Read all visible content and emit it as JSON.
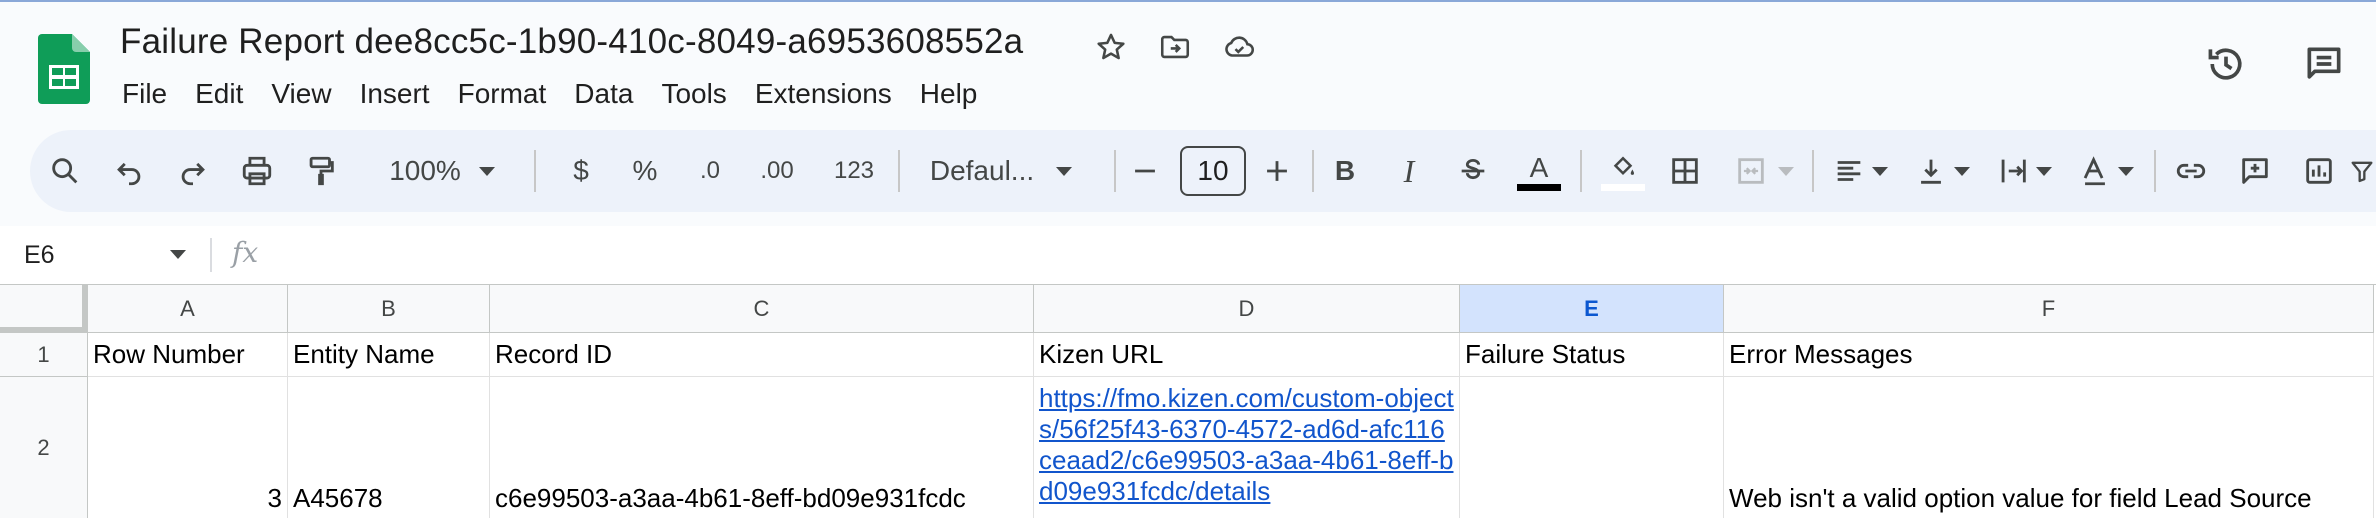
{
  "doc": {
    "title": "Failure Report dee8cc5c-1b90-410c-8049-a6953608552a"
  },
  "menu": [
    "File",
    "Edit",
    "View",
    "Insert",
    "Format",
    "Data",
    "Tools",
    "Extensions",
    "Help"
  ],
  "toolbar": {
    "zoom": "100%",
    "currency": "$",
    "percent": "%",
    "decrease_decimal": ".0",
    "increase_decimal": ".00",
    "more_formats": "123",
    "font": "Defaul...",
    "font_size": "10",
    "bold": "B",
    "italic": "I",
    "text_color": "A"
  },
  "formula_bar": {
    "cell_ref": "E6",
    "fx": "fx",
    "value": ""
  },
  "grid": {
    "columns": [
      "A",
      "B",
      "C",
      "D",
      "E",
      "F"
    ],
    "selected_column": "E",
    "rows": [
      "1",
      "2"
    ],
    "header_row": [
      "Row Number",
      "Entity Name",
      "Record ID",
      "Kizen URL",
      "Failure Status",
      "Error Messages"
    ],
    "data_row": {
      "row_number": "3",
      "entity_name": "A45678",
      "record_id": "c6e99503-a3aa-4b61-8eff-bd09e931fcdc",
      "kizen_url": "https://fmo.kizen.com/custom-objects/56f25f43-6370-4572-ad6d-afc116ceaad2/c6e99503-a3aa-4b61-8eff-bd09e931fcdc/details",
      "failure_status": "",
      "error_messages": "Web isn't a valid option value for field Lead Source"
    }
  },
  "colors": {
    "sheets_green": "#0f9d58",
    "link_blue": "#1155cc",
    "selected_header": "#d3e3fd",
    "toolbar_bg": "#edf2fa"
  },
  "icons": {
    "header": [
      "sheets-logo-icon",
      "star-icon",
      "move-to-folder-icon",
      "cloud-saved-icon",
      "version-history-icon",
      "comments-icon"
    ],
    "toolbar": [
      "search-icon",
      "undo-icon",
      "redo-icon",
      "print-icon",
      "paint-format-icon",
      "minus-icon",
      "plus-icon",
      "strikethrough-icon",
      "fill-color-icon",
      "borders-icon",
      "merge-cells-icon",
      "align-left-icon",
      "vertical-align-icon",
      "text-wrap-icon",
      "text-rotation-icon",
      "link-icon",
      "insert-comment-icon",
      "insert-chart-icon",
      "filter-icon"
    ]
  }
}
